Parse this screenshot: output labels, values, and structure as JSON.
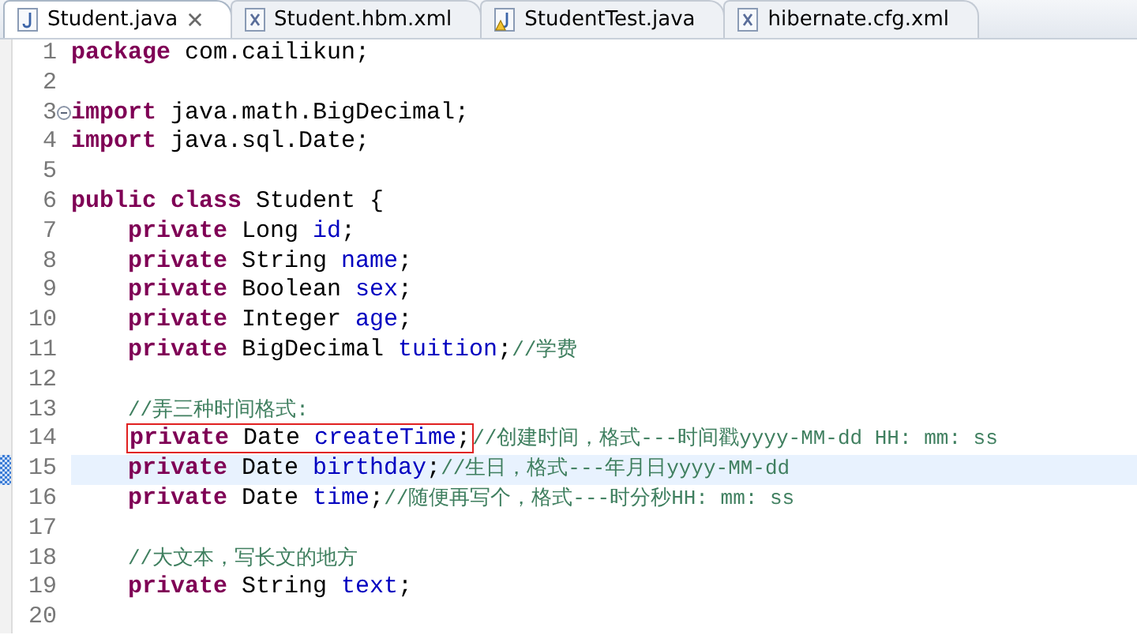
{
  "tabs": [
    {
      "label": "Student.java",
      "kind": "java",
      "selected": true,
      "closable": true
    },
    {
      "label": "Student.hbm.xml",
      "kind": "xml",
      "selected": false,
      "closable": false
    },
    {
      "label": "StudentTest.java",
      "kind": "java-warning",
      "selected": false,
      "closable": false
    },
    {
      "label": "hibernate.cfg.xml",
      "kind": "xml",
      "selected": false,
      "closable": false
    }
  ],
  "lines": [
    {
      "number": "1",
      "indented": false,
      "folding": false,
      "current": false,
      "marked": false,
      "tokens": [
        {
          "kind": "keyword",
          "text": "package"
        },
        {
          "kind": "plain",
          "text": " com.cailikun;"
        }
      ]
    },
    {
      "number": "2",
      "folding": false,
      "current": false,
      "marked": false
    },
    {
      "number": "3",
      "indented": false,
      "folding": true,
      "current": false,
      "marked": false,
      "tokens": [
        {
          "kind": "keyword",
          "text": "import"
        },
        {
          "kind": "plain",
          "text": " java.math.BigDecimal;"
        }
      ]
    },
    {
      "number": "4",
      "indented": false,
      "folding": false,
      "current": false,
      "marked": false,
      "tokens": [
        {
          "kind": "keyword",
          "text": "import"
        },
        {
          "kind": "plain",
          "text": " java.sql.Date;"
        }
      ]
    },
    {
      "number": "5",
      "folding": false,
      "current": false,
      "marked": false
    },
    {
      "number": "6",
      "indented": false,
      "folding": false,
      "current": false,
      "marked": false,
      "tokens": [
        {
          "kind": "keyword",
          "text": "public class"
        },
        {
          "kind": "plain",
          "text": " Student {"
        }
      ]
    },
    {
      "number": "7",
      "indented": true,
      "folding": false,
      "current": false,
      "marked": false,
      "tokens": [
        {
          "kind": "keyword",
          "text": "private"
        },
        {
          "kind": "plain",
          "text": " Long "
        },
        {
          "kind": "field",
          "text": "id"
        },
        {
          "kind": "plain",
          "text": ";"
        }
      ]
    },
    {
      "number": "8",
      "indented": true,
      "folding": false,
      "current": false,
      "marked": false,
      "tokens": [
        {
          "kind": "keyword",
          "text": "private"
        },
        {
          "kind": "plain",
          "text": " String "
        },
        {
          "kind": "field",
          "text": "name"
        },
        {
          "kind": "plain",
          "text": ";"
        }
      ]
    },
    {
      "number": "9",
      "indented": true,
      "folding": false,
      "current": false,
      "marked": false,
      "tokens": [
        {
          "kind": "keyword",
          "text": "private"
        },
        {
          "kind": "plain",
          "text": " Boolean "
        },
        {
          "kind": "field",
          "text": "sex"
        },
        {
          "kind": "plain",
          "text": ";"
        }
      ]
    },
    {
      "number": "10",
      "indented": true,
      "folding": false,
      "current": false,
      "marked": false,
      "tokens": [
        {
          "kind": "keyword",
          "text": "private"
        },
        {
          "kind": "plain",
          "text": " Integer "
        },
        {
          "kind": "field",
          "text": "age"
        },
        {
          "kind": "plain",
          "text": ";"
        }
      ]
    },
    {
      "number": "11",
      "indented": true,
      "folding": false,
      "current": false,
      "marked": false,
      "tokens": [
        {
          "kind": "keyword",
          "text": "private"
        },
        {
          "kind": "plain",
          "text": " BigDecimal "
        },
        {
          "kind": "field",
          "text": "tuition"
        },
        {
          "kind": "plain",
          "text": ";"
        },
        {
          "kind": "comment",
          "text": "//学费"
        }
      ]
    },
    {
      "number": "12",
      "folding": false,
      "current": false,
      "marked": false
    },
    {
      "number": "13",
      "indented": true,
      "folding": false,
      "current": false,
      "marked": false,
      "tokens": [
        {
          "kind": "comment",
          "text": "//弄三种时间格式:"
        }
      ]
    },
    {
      "number": "14",
      "indented": true,
      "folding": false,
      "current": false,
      "marked": false,
      "tokens": [
        {
          "kind": "box",
          "tokens": [
            {
              "kind": "keyword",
              "text": "private"
            },
            {
              "kind": "plain",
              "text": " Date "
            },
            {
              "kind": "field",
              "text": "createTime"
            },
            {
              "kind": "plain",
              "text": ";"
            }
          ]
        },
        {
          "kind": "comment",
          "text": "//创建时间，格式---时间戳yyyy-MM-dd HH: mm: ss"
        }
      ]
    },
    {
      "number": "15",
      "indented": true,
      "folding": false,
      "current": true,
      "marked": true,
      "tokens": [
        {
          "kind": "keyword",
          "text": "private"
        },
        {
          "kind": "plain",
          "text": " Date "
        },
        {
          "kind": "field",
          "text": "birthday"
        },
        {
          "kind": "plain",
          "text": ";"
        },
        {
          "kind": "comment",
          "text": "//生日，格式---年月日yyyy-MM-dd"
        }
      ]
    },
    {
      "number": "16",
      "indented": true,
      "folding": false,
      "current": false,
      "marked": false,
      "tokens": [
        {
          "kind": "keyword",
          "text": "private"
        },
        {
          "kind": "plain",
          "text": " Date "
        },
        {
          "kind": "field",
          "text": "time"
        },
        {
          "kind": "plain",
          "text": ";"
        },
        {
          "kind": "comment",
          "text": "//随便再写个，格式---时分秒HH: mm: ss"
        }
      ]
    },
    {
      "number": "17",
      "folding": false,
      "current": false,
      "marked": false
    },
    {
      "number": "18",
      "indented": true,
      "folding": false,
      "current": false,
      "marked": false,
      "tokens": [
        {
          "kind": "comment",
          "text": "//大文本，写长文的地方"
        }
      ]
    },
    {
      "number": "19",
      "indented": true,
      "folding": false,
      "current": false,
      "marked": false,
      "tokens": [
        {
          "kind": "keyword",
          "text": "private"
        },
        {
          "kind": "plain",
          "text": " String "
        },
        {
          "kind": "field",
          "text": "text"
        },
        {
          "kind": "plain",
          "text": ";"
        }
      ]
    },
    {
      "number": "20",
      "folding": false,
      "current": false,
      "marked": false
    }
  ]
}
